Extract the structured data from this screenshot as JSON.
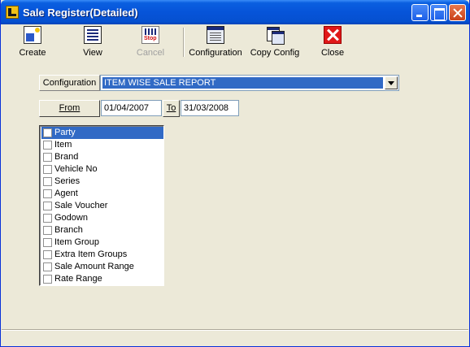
{
  "window": {
    "title": "Sale Register(Detailed)"
  },
  "toolbar": {
    "create_label": "Create",
    "view_label": "View",
    "cancel_label": "Cancel",
    "configuration_label": "Configuration",
    "copy_config_label": "Copy Config",
    "close_label": "Close"
  },
  "form": {
    "configuration_label": "Configuration",
    "configuration_value": "ITEM WISE SALE REPORT",
    "from_label": "From",
    "from_date": "01/04/2007",
    "to_label": "To",
    "to_date": "31/03/2008"
  },
  "filters": {
    "items": [
      {
        "label": "Party",
        "checked": false,
        "selected": true
      },
      {
        "label": "Item",
        "checked": false,
        "selected": false
      },
      {
        "label": "Brand",
        "checked": false,
        "selected": false
      },
      {
        "label": "Vehicle No",
        "checked": false,
        "selected": false
      },
      {
        "label": "Series",
        "checked": false,
        "selected": false
      },
      {
        "label": "Agent",
        "checked": false,
        "selected": false
      },
      {
        "label": "Sale Voucher",
        "checked": false,
        "selected": false
      },
      {
        "label": "Godown",
        "checked": false,
        "selected": false
      },
      {
        "label": "Branch",
        "checked": false,
        "selected": false
      },
      {
        "label": "Item Group",
        "checked": false,
        "selected": false
      },
      {
        "label": "Extra Item Groups",
        "checked": false,
        "selected": false
      },
      {
        "label": "Sale Amount Range",
        "checked": false,
        "selected": false
      },
      {
        "label": "Rate Range",
        "checked": false,
        "selected": false
      }
    ]
  },
  "colors": {
    "titlebar": "#0654d9",
    "selection": "#316ac5",
    "window_bg": "#ece9d8"
  }
}
